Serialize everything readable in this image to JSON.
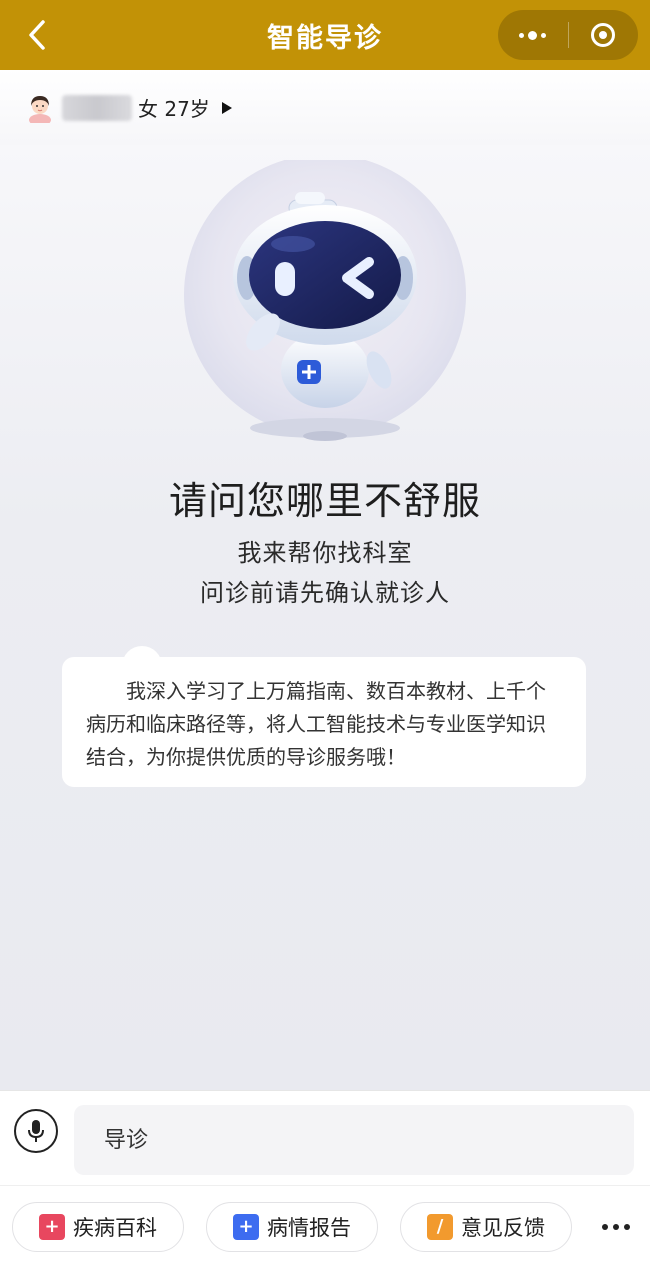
{
  "header": {
    "title": "智能导诊",
    "accent_color": "#C29206"
  },
  "patient": {
    "name_hidden": true,
    "info": "女 27岁"
  },
  "main": {
    "headline": "请问您哪里不舒服",
    "subline1": "我来帮你找科室",
    "subline2": "问诊前请先确认就诊人",
    "bubble_text": "我深入学习了上万篇指南、数百本教材、上千个病历和临床路径等，将人工智能技术与专业医学知识结合，为你提供优质的导诊服务哦！"
  },
  "input": {
    "placeholder": "导诊"
  },
  "quick_actions": [
    {
      "label": "疾病百科",
      "icon": "encyclopedia-icon",
      "color": "#E8475F"
    },
    {
      "label": "病情报告",
      "icon": "plus-report-icon",
      "color": "#3D6CF0"
    },
    {
      "label": "意见反馈",
      "icon": "feedback-icon",
      "color": "#F29A2E"
    }
  ]
}
